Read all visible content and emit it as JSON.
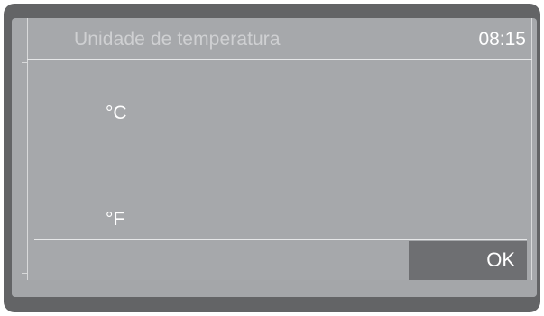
{
  "header": {
    "title": "Unidade de temperatura",
    "time": "08:15"
  },
  "options": [
    {
      "label": "°C"
    },
    {
      "label": "°F"
    }
  ],
  "footer": {
    "ok_label": "OK"
  },
  "colors": {
    "bezel": "#636466",
    "screen": "#a6a8ab",
    "button": "#6e6f72",
    "text": "#ffffff",
    "title_text": "#cfd0d2"
  }
}
